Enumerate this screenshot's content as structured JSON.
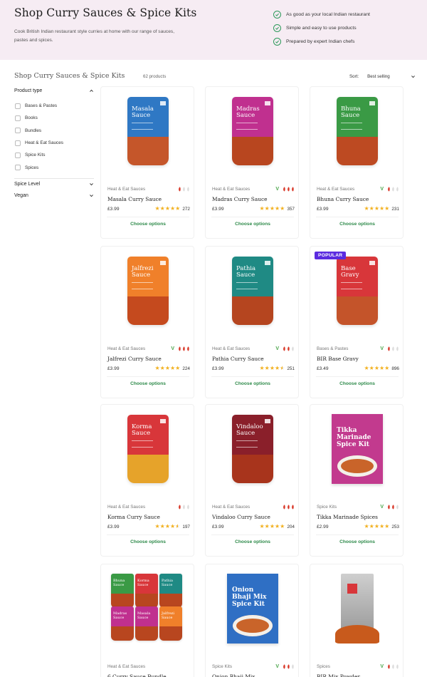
{
  "hero": {
    "title": "Shop Curry Sauces & Spice Kits",
    "description": "Cook British Indian restaurant style curries at home with our range of sauces, pastes and spices.",
    "benefits": [
      "As good as your local Indian restaurant",
      "Simple and easy to use products",
      "Prepared by expert Indian chefs"
    ],
    "background": "#f6ecf3",
    "check_color": "#2e9a5b"
  },
  "toolbar": {
    "heading": "Shop Curry Sauces & Spice Kits",
    "count": "62 products",
    "sort_label": "Sort:",
    "sort_value": "Best selling"
  },
  "filters": {
    "product_type_title": "Product type",
    "options": [
      "Bases & Pastes",
      "Books",
      "Bundles",
      "Heat & Eat Sauces",
      "Spice Kits",
      "Spices"
    ],
    "spice_level_title": "Spice Level",
    "vegan_title": "Vegan"
  },
  "colors": {
    "accent_green": "#2e8a4a",
    "star": "#f2b01e",
    "popular_badge": "#5b2be0",
    "chili_red": "#d93a2b",
    "chili_empty": "#dcdcdc"
  },
  "products": [
    {
      "name": "Masala Curry Sauce",
      "pouch_label": "Masala\nSauce",
      "category": "Heat & Eat Sauces",
      "price": "£3.99",
      "rating": 4.9,
      "reviews": "272",
      "heat": 1,
      "vegan": false,
      "color": "#2f78c4",
      "fill": "#c5562a",
      "type": "pouch",
      "cta": "Choose options"
    },
    {
      "name": "Madras Curry Sauce",
      "pouch_label": "Madras\nSauce",
      "category": "Heat & Eat Sauces",
      "price": "£3.99",
      "rating": 4.9,
      "reviews": "357",
      "heat": 3,
      "vegan": true,
      "color": "#c0308f",
      "fill": "#b8461f",
      "type": "pouch",
      "cta": "Choose options"
    },
    {
      "name": "Bhuna Curry Sauce",
      "pouch_label": "Bhuna\nSauce",
      "category": "Heat & Eat Sauces",
      "price": "£3.99",
      "rating": 4.9,
      "reviews": "231",
      "heat": 1,
      "vegan": true,
      "color": "#3a9a45",
      "fill": "#bd4a22",
      "type": "pouch",
      "cta": "Choose options"
    },
    {
      "name": "Jalfrezi Curry Sauce",
      "pouch_label": "Jalfrezi\nSauce",
      "category": "Heat & Eat Sauces",
      "price": "£3.99",
      "rating": 4.9,
      "reviews": "224",
      "heat": 3,
      "vegan": true,
      "color": "#f0802a",
      "fill": "#c54a1e",
      "type": "pouch",
      "cta": "Choose options"
    },
    {
      "name": "Pathia Curry Sauce",
      "pouch_label": "Pathia\nSauce",
      "category": "Heat & Eat Sauces",
      "price": "£3.99",
      "rating": 4.6,
      "reviews": "251",
      "heat": 2,
      "vegan": true,
      "color": "#1f8a84",
      "fill": "#b5451f",
      "type": "pouch",
      "cta": "Choose options"
    },
    {
      "name": "BIR Base Gravy",
      "pouch_label": "Base\nGravy",
      "category": "Bases & Pastes",
      "price": "£3.49",
      "rating": 4.9,
      "reviews": "896",
      "heat": 1,
      "vegan": true,
      "color": "#d8363a",
      "fill": "#c4542a",
      "type": "pouch",
      "popular": "POPULAR",
      "cta": "Choose options"
    },
    {
      "name": "Korma Curry Sauce",
      "pouch_label": "Korma\nSauce",
      "category": "Heat & Eat Sauces",
      "price": "£3.99",
      "rating": 4.6,
      "reviews": "197",
      "heat": 1,
      "vegan": false,
      "color": "#d8363a",
      "fill": "#e6a32a",
      "type": "pouch",
      "cta": "Choose options"
    },
    {
      "name": "Vindaloo Curry Sauce",
      "pouch_label": "Vindaloo\nSauce",
      "category": "Heat & Eat Sauces",
      "price": "£3.99",
      "rating": 4.9,
      "reviews": "204",
      "heat": 3,
      "vegan": false,
      "color": "#8a1f2a",
      "fill": "#a8341c",
      "type": "pouch",
      "cta": "Choose options"
    },
    {
      "name": "Tikka Marinade Spices",
      "pouch_label": "Tikka\nMarinade\nSpice Kit",
      "category": "Spice Kits",
      "price": "£2.99",
      "rating": 4.9,
      "reviews": "253",
      "heat": 2,
      "vegan": true,
      "color": "#c23a8e",
      "fill": "#c23a8e",
      "type": "kit",
      "cta": "Choose options"
    },
    {
      "name": "6 Curry Sauce Bundle",
      "pouch_label": "Bundle",
      "category": "Heat & Eat Sauces",
      "type": "bundle",
      "heat": 0,
      "vegan": false
    },
    {
      "name": "Onion Bhaji Mix",
      "pouch_label": "Onion\nBhaji Mix\nSpice Kit",
      "category": "Spice Kits",
      "type": "kit",
      "heat": 2,
      "vegan": true,
      "color": "#2f6fc4",
      "fill": "#2f6fc4"
    },
    {
      "name": "BIR Mix Powder",
      "pouch_label": "",
      "category": "Spices",
      "type": "spice",
      "heat": 1,
      "vegan": true
    }
  ]
}
